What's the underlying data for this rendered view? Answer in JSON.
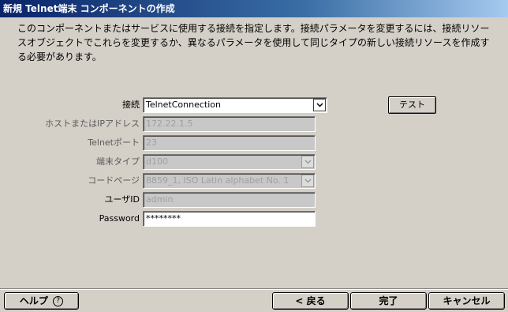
{
  "window": {
    "title": "新規 Telnet端末 コンポーネントの作成"
  },
  "instruction": "このコンポーネントまたはサービスに使用する接続を指定します。接続パラメータを変更するには、接続リソースオブジェクトでこれらを変更するか、異なるパラメータを使用して同じタイプの新しい接続リソースを作成する必要があります。",
  "form": {
    "connection": {
      "label": "接続",
      "value": "TelnetConnection"
    },
    "test_button": "テスト",
    "host": {
      "label": "ホストまたはIPアドレス",
      "value": "172.22.1.5"
    },
    "port": {
      "label": "Telnetポート",
      "value": "23"
    },
    "terminal_type": {
      "label": "端末タイプ",
      "value": "d100"
    },
    "code_page": {
      "label": "コードページ",
      "value": "8859_1, ISO Latin alphabet No. 1"
    },
    "user_id": {
      "label": "ユーザID",
      "value": "admin"
    },
    "password": {
      "label": "Password",
      "value": "********"
    }
  },
  "footer": {
    "help": "ヘルプ",
    "help_icon": "?",
    "back": "< 戻る",
    "finish": "完了",
    "cancel": "キャンセル"
  },
  "icons": {
    "dropdown": "chevron-down-icon",
    "help": "question-circle-icon"
  }
}
